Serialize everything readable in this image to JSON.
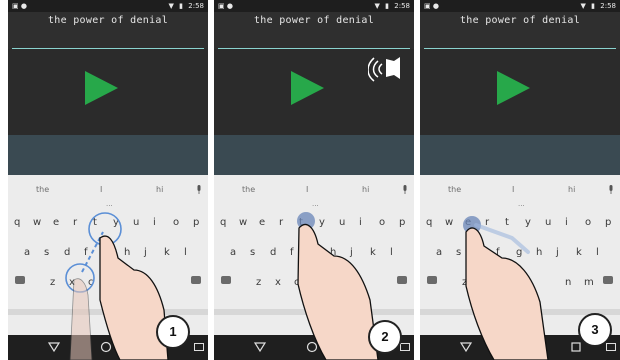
{
  "status": {
    "right_time": "2:58"
  },
  "app": {
    "title": "the power of denial"
  },
  "suggestions": [
    "the",
    "I",
    "hi"
  ],
  "keyboard": {
    "row1": [
      "q",
      "w",
      "e",
      "r",
      "t",
      "y",
      "u",
      "i",
      "o",
      "p"
    ],
    "row2": [
      "a",
      "s",
      "d",
      "f",
      "g",
      "h",
      "j",
      "k",
      "l"
    ],
    "row3": [
      "z",
      "x",
      "c",
      "v",
      "b",
      "n",
      "m"
    ],
    "ellipsis": "..."
  },
  "badges": [
    "1",
    "2",
    "3"
  ],
  "colors": {
    "play": "#27a84a",
    "app_bg": "#2b2b2b",
    "band": "#3a4a52",
    "underline": "#8ad3cf"
  },
  "icons": [
    "play-icon",
    "speaker-icon",
    "mic-icon",
    "backspace-icon",
    "back-icon",
    "home-icon",
    "recents-icon",
    "keyboard-icon",
    "hand-icon"
  ]
}
